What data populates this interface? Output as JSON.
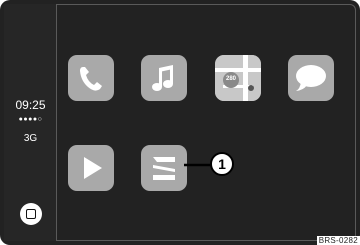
{
  "status": {
    "time": "09:25",
    "signal": "●●●●○",
    "network": "3G"
  },
  "apps": [
    {
      "name": "phone",
      "icon": "phone-icon"
    },
    {
      "name": "music",
      "icon": "music-note-icon"
    },
    {
      "name": "maps",
      "icon": "map-icon",
      "badge": "280"
    },
    {
      "name": "messages",
      "icon": "message-bubble-icon"
    },
    {
      "name": "podcasts",
      "icon": "play-icon"
    },
    {
      "name": "seat",
      "icon": "seat-logo-icon"
    }
  ],
  "callout": {
    "number": "1"
  },
  "figure_code": "BRS-0282",
  "colors": {
    "screen": "#222222",
    "tile": "#a9a9a9",
    "glyph": "#ffffff"
  }
}
